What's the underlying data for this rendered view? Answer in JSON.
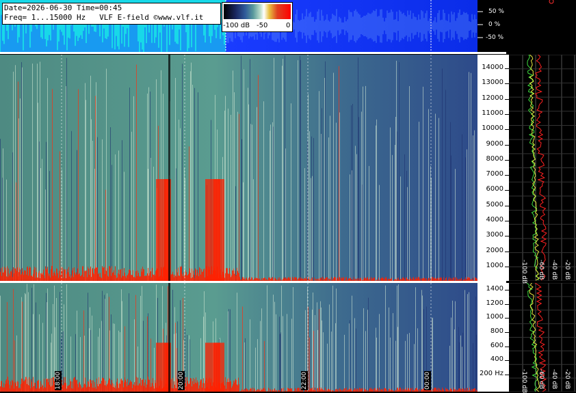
{
  "header": {
    "date_line": "Date=2026-06-30 Time=00:45",
    "freq_line": "Freq= 1...15000 Hz   VLF E-field ©www.vlf.it"
  },
  "intensity_scale": {
    "labels": [
      "-100 dB",
      "-50",
      "0"
    ]
  },
  "waveform_axis": {
    "labels": [
      "50 %",
      "0 %",
      "-50 %"
    ]
  },
  "upper_spectrogram": {
    "freq_ticks": [
      "14000",
      "13000",
      "12000",
      "11000",
      "10000",
      "9000",
      "8000",
      "7000",
      "6000",
      "5000",
      "4000",
      "3000",
      "2000",
      "1000"
    ]
  },
  "lower_spectrogram": {
    "freq_ticks": [
      "1400",
      "1200",
      "1000",
      "800",
      "600",
      "400",
      "200 Hz"
    ]
  },
  "spectrum_axis": {
    "upper_labels": [
      "-100 dB",
      "-60 dB",
      "-40 dB",
      "-20 dB"
    ],
    "lower_labels": [
      "-100 dB",
      "-60 dB",
      "-40 dB",
      "-20 dB"
    ]
  },
  "time_axis": {
    "labels": [
      "18:00",
      "20:00",
      "22:00",
      "00:00"
    ]
  },
  "colors": {
    "waveform_cyan": "#18d8e8",
    "waveform_blue": "#1a3cff",
    "spectrogram_red": "#ff2000",
    "spectrum_yellow": "#e8e840",
    "spectrum_green": "#40e040",
    "spectrum_red": "#ff2020"
  }
}
